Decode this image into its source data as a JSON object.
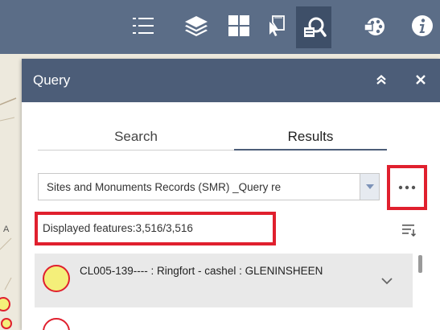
{
  "map": {
    "edge_label": "A"
  },
  "toolbar": {
    "tools": [
      {
        "name": "legend-icon"
      },
      {
        "name": "layers-icon"
      },
      {
        "name": "basemap-gallery-icon"
      },
      {
        "name": "select-icon"
      },
      {
        "name": "query-icon",
        "active": true
      },
      {
        "name": "print-icon"
      },
      {
        "name": "info-icon"
      }
    ]
  },
  "panel": {
    "title": "Query",
    "tabs": {
      "search": "Search",
      "results": "Results"
    },
    "layer_select": {
      "value": "Sites and Monuments Records (SMR) _Query re"
    },
    "displayed_features": "Displayed features:3,516/3,516",
    "results": [
      {
        "title": "CL005-139---- : Ringfort - cashel : GLENINSHEEN",
        "symbol_fill": "#f4ef7a",
        "symbol_outline": "#e0202e"
      }
    ]
  },
  "colors": {
    "toolbar_bg": "#5b6d87",
    "panel_header_bg": "#4c5d78",
    "highlight_red": "#e0202e"
  }
}
